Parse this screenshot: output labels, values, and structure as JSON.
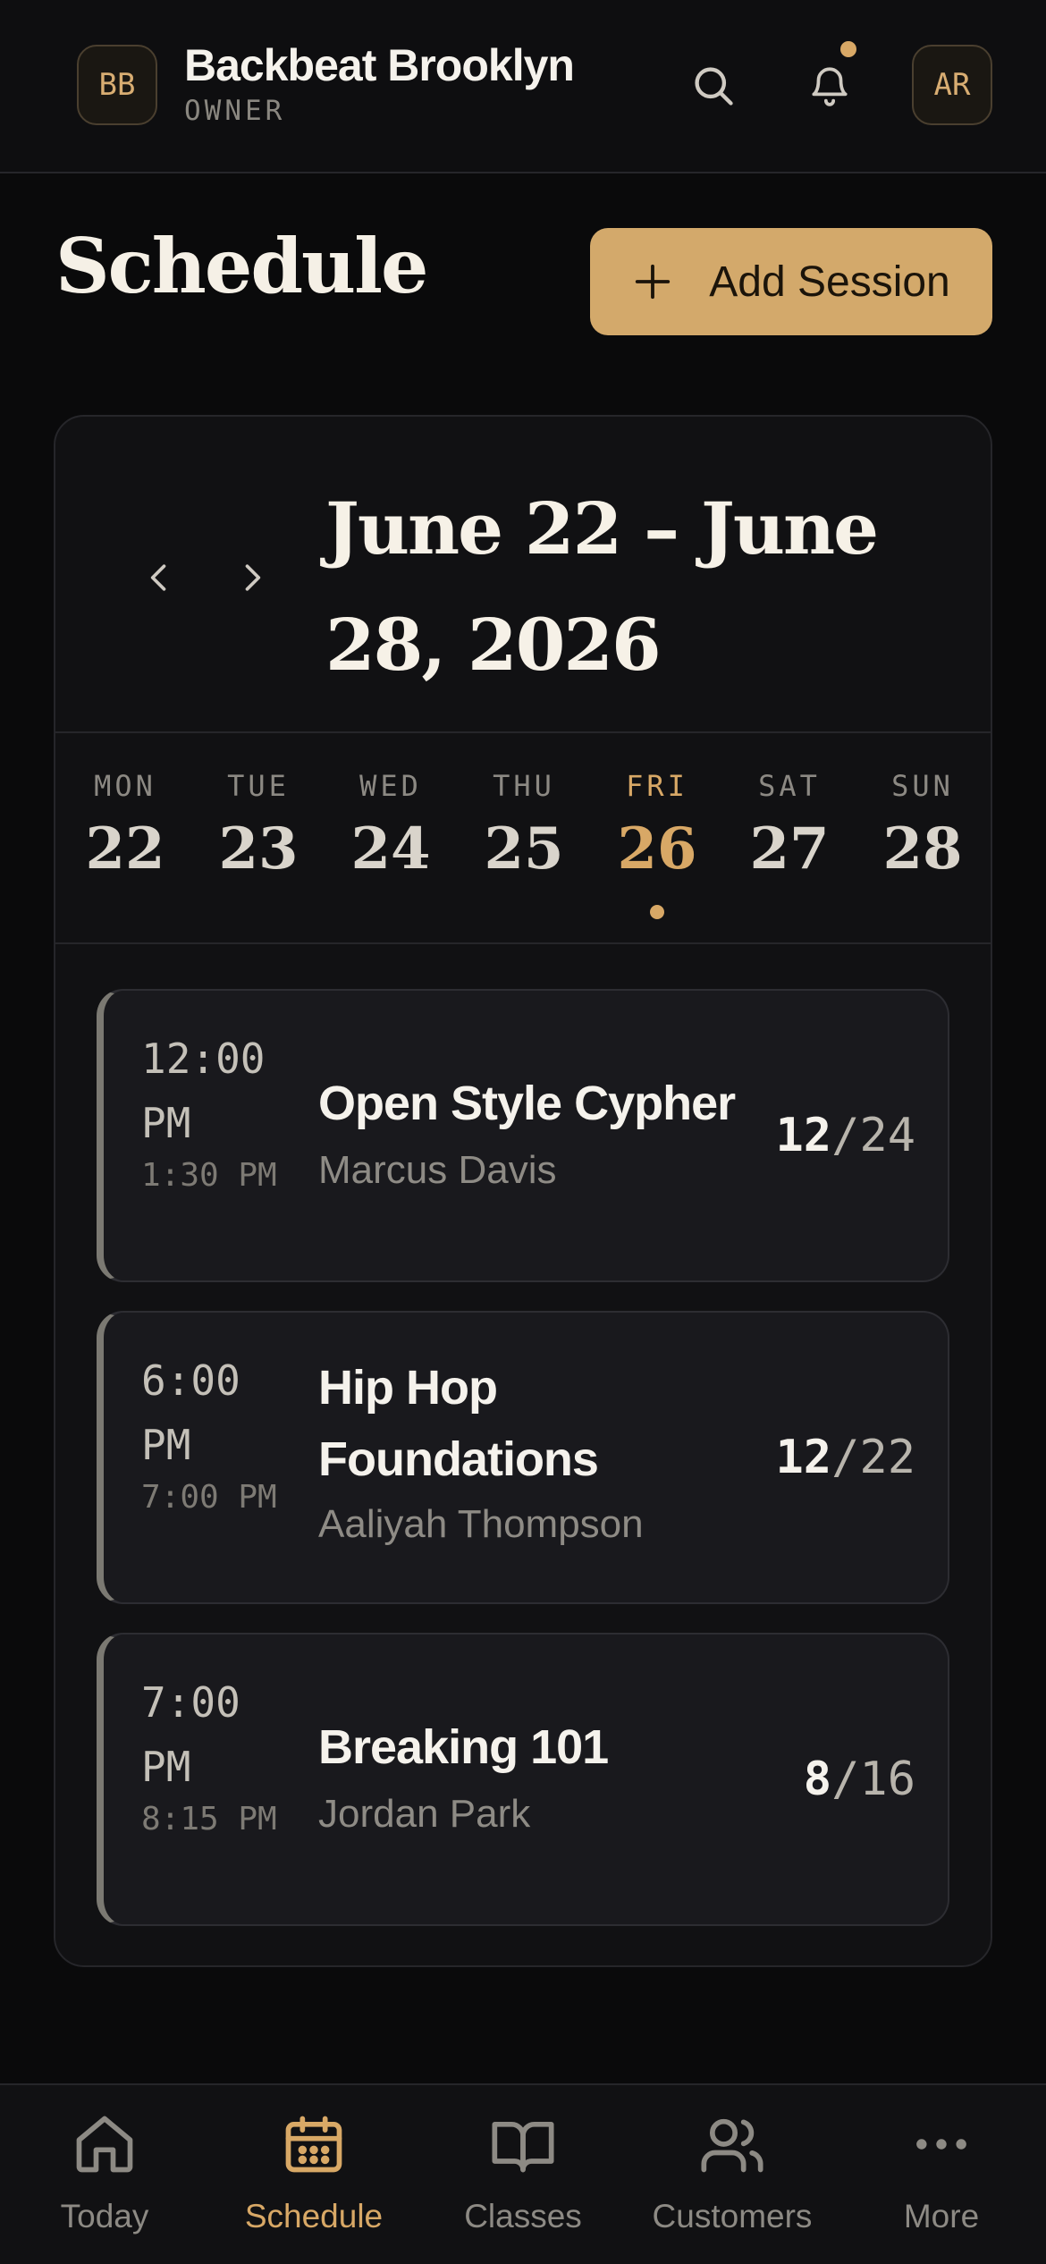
{
  "header": {
    "studio_initials": "BB",
    "studio_name": "Backbeat Brooklyn",
    "role": "OWNER",
    "user_initials": "AR"
  },
  "page": {
    "title": "Schedule",
    "add_button": "Add Session"
  },
  "week": {
    "range": "June 22 – June 28, 2026",
    "days": [
      {
        "name": "MON",
        "num": "22"
      },
      {
        "name": "TUE",
        "num": "23"
      },
      {
        "name": "WED",
        "num": "24"
      },
      {
        "name": "THU",
        "num": "25"
      },
      {
        "name": "FRI",
        "num": "26"
      },
      {
        "name": "SAT",
        "num": "27"
      },
      {
        "name": "SUN",
        "num": "28"
      }
    ],
    "selected_day": "FRI"
  },
  "sessions": [
    {
      "start": "12:00 PM",
      "end": "1:30 PM",
      "title": "Open Style Cypher",
      "instructor": "Marcus Davis",
      "booked": "12",
      "capacity": "/24"
    },
    {
      "start": "6:00 PM",
      "end": "7:00 PM",
      "title": "Hip Hop Foundations",
      "instructor": "Aaliyah Thompson",
      "booked": "12",
      "capacity": "/22"
    },
    {
      "start": "7:00 PM",
      "end": "8:15 PM",
      "title": "Breaking 101",
      "instructor": "Jordan Park",
      "booked": "8",
      "capacity": "/16"
    }
  ],
  "nav": {
    "items": [
      {
        "label": "Today",
        "icon": "home-icon"
      },
      {
        "label": "Schedule",
        "icon": "calendar-icon"
      },
      {
        "label": "Classes",
        "icon": "book-icon"
      },
      {
        "label": "Customers",
        "icon": "users-icon"
      },
      {
        "label": "More",
        "icon": "more-icon"
      }
    ],
    "active": "Schedule"
  },
  "colors": {
    "accent": "#d8a866",
    "background": "#0a0a0b",
    "card": "#111113"
  }
}
